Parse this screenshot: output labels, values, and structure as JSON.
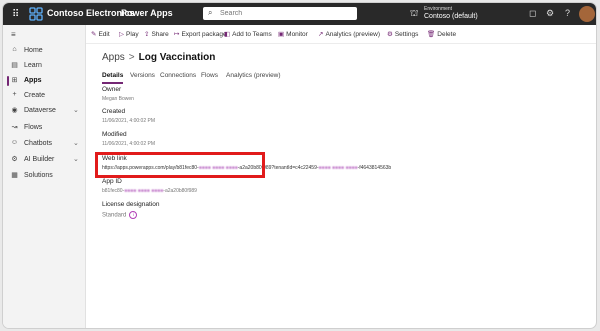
{
  "topbar": {
    "brand": "Contoso Electronics",
    "product": "Power Apps",
    "search_placeholder": "Search",
    "environment_label": "Environment",
    "environment_name": "Contoso (default)"
  },
  "sidebar": {
    "items": [
      {
        "label": "Home",
        "icon": "home-icon",
        "glyph": "⌂",
        "chevron": false,
        "active": false
      },
      {
        "label": "Learn",
        "icon": "book-icon",
        "glyph": "▤",
        "chevron": false,
        "active": false
      },
      {
        "label": "Apps",
        "icon": "apps-icon",
        "glyph": "⊞",
        "chevron": false,
        "active": true
      },
      {
        "label": "Create",
        "icon": "plus-icon",
        "glyph": "+",
        "chevron": false,
        "active": false
      },
      {
        "label": "Dataverse",
        "icon": "dataverse-icon",
        "glyph": "◉",
        "chevron": true,
        "active": false
      },
      {
        "label": "Flows",
        "icon": "flows-icon",
        "glyph": "↝",
        "chevron": false,
        "active": false
      },
      {
        "label": "Chatbots",
        "icon": "chatbot-icon",
        "glyph": "☺",
        "chevron": true,
        "active": false
      },
      {
        "label": "AI Builder",
        "icon": "ai-builder-icon",
        "glyph": "⚙",
        "chevron": true,
        "active": false
      },
      {
        "label": "Solutions",
        "icon": "solutions-icon",
        "glyph": "▦",
        "chevron": false,
        "active": false
      }
    ]
  },
  "commands": [
    {
      "label": "Edit",
      "icon": "edit-icon",
      "glyph": "✎"
    },
    {
      "label": "Play",
      "icon": "play-icon",
      "glyph": "▷"
    },
    {
      "label": "Share",
      "icon": "share-icon",
      "glyph": "⇪"
    },
    {
      "label": "Export package",
      "icon": "export-icon",
      "glyph": "↦"
    },
    {
      "label": "Add to Teams",
      "icon": "teams-icon",
      "glyph": "◧"
    },
    {
      "label": "Monitor",
      "icon": "monitor-icon",
      "glyph": "▣"
    },
    {
      "label": "Analytics (preview)",
      "icon": "analytics-icon",
      "glyph": "↗"
    },
    {
      "label": "Settings",
      "icon": "settings-icon",
      "glyph": "⚙"
    },
    {
      "label": "Delete",
      "icon": "delete-icon",
      "glyph": "🗑"
    }
  ],
  "breadcrumb": {
    "parent": "Apps",
    "separator": ">",
    "current": "Log Vaccination"
  },
  "tabs": [
    "Details",
    "Versions",
    "Connections",
    "Flows",
    "Analytics (preview)"
  ],
  "details": {
    "owner_label": "Owner",
    "owner_value": "Megan Bowen",
    "created_label": "Created",
    "created_value": "11/06/2021, 4:00:02 PM",
    "modified_label": "Modified",
    "modified_value": "11/06/2021, 4:00:02 PM",
    "weblink_label": "Web link",
    "weblink_prefix": "https://apps.powerapps.com/play/b81fec80-",
    "weblink_mid": "-a2a20b80f989?tenantId=c4c22459-",
    "weblink_suffix": "-f4643814563b",
    "appid_label": "App ID",
    "appid_value": "b81fec80-",
    "appid_suffix": "-a2a20b80f989",
    "license_label": "License designation",
    "license_value": "Standard"
  }
}
